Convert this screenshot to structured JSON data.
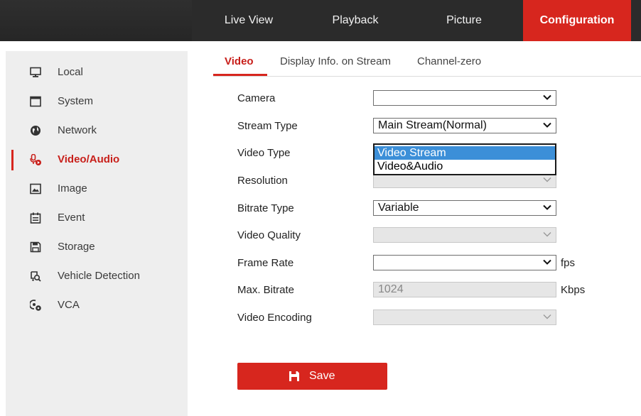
{
  "topnav": {
    "items": [
      {
        "label": "Live View"
      },
      {
        "label": "Playback"
      },
      {
        "label": "Picture"
      },
      {
        "label": "Configuration"
      }
    ],
    "active_index": 3,
    "accent_color": "#d7261e"
  },
  "sidebar": {
    "items": [
      {
        "label": "Local",
        "icon": "monitor-icon"
      },
      {
        "label": "System",
        "icon": "window-icon"
      },
      {
        "label": "Network",
        "icon": "globe-icon"
      },
      {
        "label": "Video/Audio",
        "icon": "microphone-video-icon"
      },
      {
        "label": "Image",
        "icon": "picture-icon"
      },
      {
        "label": "Event",
        "icon": "calendar-icon"
      },
      {
        "label": "Storage",
        "icon": "floppy-disk-icon"
      },
      {
        "label": "Vehicle Detection",
        "icon": "vehicle-search-icon"
      },
      {
        "label": "VCA",
        "icon": "vca-icon"
      }
    ],
    "active_index": 3
  },
  "tabs": {
    "items": [
      {
        "label": "Video"
      },
      {
        "label": "Display Info. on Stream"
      },
      {
        "label": "Channel-zero"
      }
    ],
    "active_index": 0
  },
  "form": {
    "camera": {
      "label": "Camera",
      "value": ""
    },
    "stream_type": {
      "label": "Stream Type",
      "value": "Main Stream(Normal)"
    },
    "video_type": {
      "label": "Video Type",
      "options": [
        "Video Stream",
        "Video&Audio"
      ],
      "highlighted": "Video Stream"
    },
    "resolution": {
      "label": "Resolution",
      "value": ""
    },
    "bitrate_type": {
      "label": "Bitrate Type",
      "value": "Variable"
    },
    "video_quality": {
      "label": "Video Quality",
      "value": ""
    },
    "frame_rate": {
      "label": "Frame Rate",
      "value": "",
      "unit": "fps"
    },
    "max_bitrate": {
      "label": "Max. Bitrate",
      "value": "1024",
      "unit": "Kbps"
    },
    "video_encoding": {
      "label": "Video Encoding",
      "value": ""
    }
  },
  "save_button": {
    "label": "Save",
    "icon": "floppy-disk-icon"
  }
}
